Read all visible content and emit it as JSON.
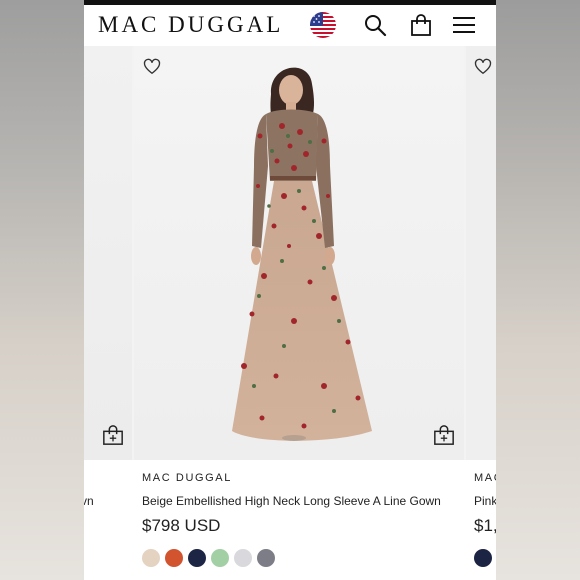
{
  "header": {
    "brand": "MAC DUGGAL",
    "icons": [
      "us-flag-icon",
      "search-icon",
      "shopping-bag-icon",
      "menu-icon"
    ]
  },
  "products": {
    "left": {
      "name_fragment": "vn"
    },
    "main": {
      "brand": "MAC DUGGAL",
      "name": "Beige Embellished High Neck Long Sleeve A Line Gown",
      "price": "$798 USD",
      "swatches": [
        "#e4d3c1",
        "#d2542f",
        "#1d2545",
        "#a3cfa4",
        "#d9d9dd",
        "#7c7d86"
      ]
    },
    "right": {
      "brand_fragment": "MAC",
      "name_fragment": "Pink",
      "price_fragment": "$1,",
      "swatches": [
        "#1c2444"
      ]
    }
  },
  "colors": {
    "accent": "#111111",
    "text": "#222222"
  }
}
